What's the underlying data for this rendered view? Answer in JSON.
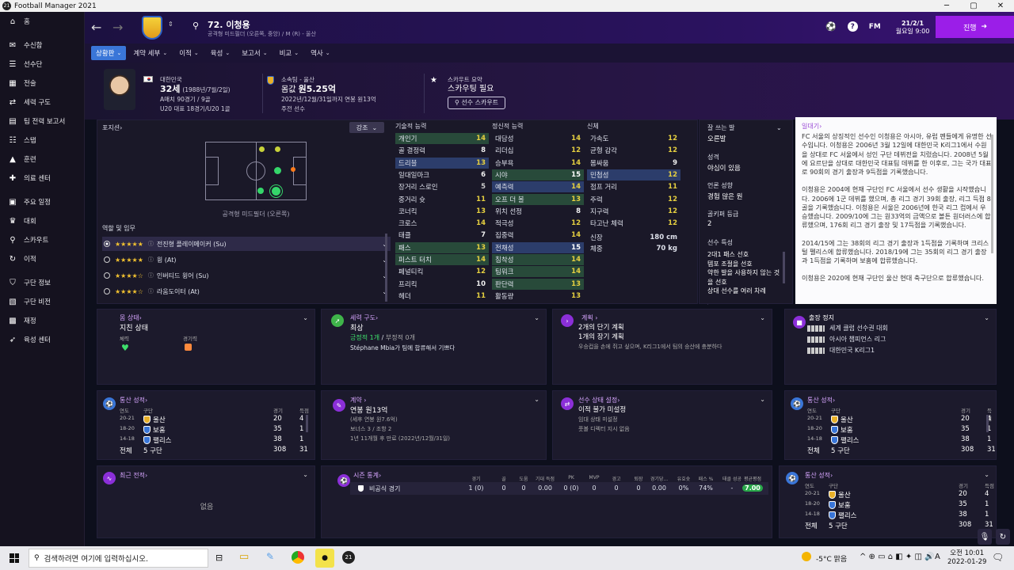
{
  "app": {
    "title": "Football Manager 2021"
  },
  "sidebar": {
    "items": [
      {
        "label": "홈",
        "icon": "home-icon"
      },
      {
        "label": "수신함",
        "icon": "inbox-icon"
      },
      {
        "label": "선수단",
        "icon": "squad-icon"
      },
      {
        "label": "전술",
        "icon": "tactics-icon"
      },
      {
        "label": "세력 구도",
        "icon": "dynamics-icon"
      },
      {
        "label": "팀 전력 보고서",
        "icon": "report-icon"
      },
      {
        "label": "스탭",
        "icon": "staff-icon"
      },
      {
        "label": "훈련",
        "icon": "training-icon"
      },
      {
        "label": "의료 센터",
        "icon": "medical-icon"
      },
      {
        "label": "주요 일정",
        "icon": "calendar-icon"
      },
      {
        "label": "대회",
        "icon": "trophy-icon"
      },
      {
        "label": "스카우트",
        "icon": "scout-icon"
      },
      {
        "label": "이적",
        "icon": "transfer-icon"
      },
      {
        "label": "구단 정보",
        "icon": "club-info-icon"
      },
      {
        "label": "구단 비전",
        "icon": "vision-icon"
      },
      {
        "label": "재정",
        "icon": "finance-icon"
      },
      {
        "label": "육성 센터",
        "icon": "development-icon"
      }
    ]
  },
  "topbar": {
    "player_title": "72. 이청용",
    "player_sub": "공격형 미드필더 (오른쪽, 중앙) / M (R) - 울산",
    "fm": "FM",
    "date": "21/2/1",
    "time": "월요일 9:00",
    "continue_label": "진행"
  },
  "tabs": [
    "상황판",
    "계약 세부",
    "이적",
    "육성",
    "보고서",
    "비교",
    "역사"
  ],
  "header": {
    "nation": "대한민국",
    "age": "32세",
    "dob": "(1988년/7월/2일)",
    "a_caps": "A매치 90경기 / 9골",
    "u_caps": "U20 대표 18경기/U20 1골",
    "club_label": "소속팀 - 울산",
    "value_label": "몸값 ",
    "value": "원5.25억",
    "contract": "2022년/12월/31일까지 연봉 원13억",
    "role": "주전 선수",
    "scout_label": "스카우트 요약",
    "scout_need": "스카우팅 필요",
    "scout_btn": "선수 스카우트"
  },
  "position": {
    "title": "포지션",
    "strong_label": "강조",
    "pitch_caption": "공격형 미드필더 (오른쪽)",
    "roles_title": "역할 및 임무",
    "roles": [
      {
        "stars": "★★★★★",
        "name": "전진형 플레이메이커 (Su)"
      },
      {
        "stars": "★★★★★",
        "name": "윙 (At)"
      },
      {
        "stars": "★★★★☆",
        "name": "인버티드 윙어 (Su)"
      },
      {
        "stars": "★★★★☆",
        "name": "라움도이터 (At)"
      }
    ]
  },
  "attributes": {
    "technical_title": "기술적 능력",
    "mental_title": "정신적 능력",
    "physical_title": "신체",
    "technical": [
      [
        "개인기",
        "14"
      ],
      [
        "골 결정력",
        "8"
      ],
      [
        "드리블",
        "13"
      ],
      [
        "일대일마크",
        "6"
      ],
      [
        "장거리 스로인",
        "5"
      ],
      [
        "중거리 슛",
        "11"
      ],
      [
        "코너킥",
        "13"
      ],
      [
        "크로스",
        "14"
      ],
      [
        "태클",
        "7"
      ],
      [
        "패스",
        "13"
      ],
      [
        "퍼스트 터치",
        "14"
      ],
      [
        "페널티킥",
        "12"
      ],
      [
        "프리킥",
        "10"
      ],
      [
        "헤더",
        "11"
      ]
    ],
    "mental": [
      [
        "대담성",
        "14"
      ],
      [
        "리더십",
        "12"
      ],
      [
        "승부욕",
        "14"
      ],
      [
        "시야",
        "15"
      ],
      [
        "예측력",
        "14"
      ],
      [
        "오프 더 볼",
        "13"
      ],
      [
        "위치 선정",
        "8"
      ],
      [
        "적극성",
        "12"
      ],
      [
        "집중력",
        "14"
      ],
      [
        "전채성",
        "15"
      ],
      [
        "침착성",
        "14"
      ],
      [
        "팀워크",
        "14"
      ],
      [
        "판단력",
        "13"
      ],
      [
        "활동량",
        "13"
      ]
    ],
    "physical": [
      [
        "가속도",
        "12"
      ],
      [
        "균형 감각",
        "12"
      ],
      [
        "몸싸움",
        "9"
      ],
      [
        "민첩성",
        "12"
      ],
      [
        "점프 거리",
        "11"
      ],
      [
        "주력",
        "12"
      ],
      [
        "지구력",
        "12"
      ],
      [
        "타고난 체력",
        "12"
      ]
    ],
    "height_label": "신장",
    "height": "180 cm",
    "weight_label": "체중",
    "weight": "70 kg"
  },
  "traits": {
    "foot_label": "잘 쓰는 발",
    "foot": "오른발",
    "personality_label": "성격",
    "personality": "야심이 있음",
    "media_label": "언론 성향",
    "media": "경험 많은 원",
    "gk_label": "골키퍼 등급",
    "gk": "2",
    "traits_label": "선수 특성",
    "traits": [
      "2대1 패스 선호",
      "템포 조절을 선호",
      "약한 발을 사용하지 않는 것을 선호",
      "상대 선수를 여러 차례"
    ]
  },
  "bio": {
    "title": "일대기",
    "p1": "FC 서울의 상징적인 선수인 이청용은 아시아, 유럽 펜들에게 유명한 선수입니다. 이청용은 2006년 3월 12일에 대한민국 K리그1에서 수원을 상대로 FC 서울에서 성인 구단 데뷔전을 치렀습니다. 2008년 5월에 요르단을 상대로 대한민국 대표팀 데뷔를 한 이후로, 그는 국가 대표로 90회의 경기 출장과 9득점을 기록했습니다.",
    "p2": "이청용은 2004에 현재 구단인 FC 서울에서 선수 생활을 시작했습니다. 2006에 1군 데뷔를 했으며, 총 리그 경기 39회 출장, 리그 득점 8골을 기록했습니다. 이청용은 서울은 2006년에 한국 리그 컵에서 우승했습니다. 2009/10에 그는 원33억의 금액으로 볼튼 원더러스에 합류했으며, 176회 리그 경기 출장 및 17득점을 기록했습니다.",
    "p3": "2014/15에 그는 38회의 리그 경기 출장과 1득점을 기록하며 크리스털 펠리스에 합류했습니다. 2018/19에 그는 35회의 리그 경기 출장과 1득점을 기록하며 보훔에 합류했습니다.",
    "p4": "이청용은 2020에 현재 구단인 울산 현대 축구단으로 합류했습니다."
  },
  "condition": {
    "title": "몸 상태",
    "value": "지친 상태",
    "fitness_label": "체력",
    "match_label": "경기력"
  },
  "dynamics": {
    "title": "세력 구도",
    "value": "최상",
    "positive": "긍정적 1개",
    "negative": "부정적 0개",
    "note": "Stéphane Mbia가 팀에 합류해서 기쁘다"
  },
  "plans": {
    "title": "계획",
    "short": "2개의 단기 계획",
    "long": "1개의 장기 계획",
    "note": "우승컵을 손에 쥐고 싶으며, K리그1에서 팀의 승산에 충분하다"
  },
  "ambitions": {
    "title": "출장 정지",
    "items": [
      "세계 클럽 선수권 대회",
      "아시아 챔피언스 리그",
      "대한민국 K리그1"
    ]
  },
  "career1": {
    "title": "통산 성적",
    "cols": [
      "연도",
      "구단",
      "경기",
      "득점"
    ],
    "rows": [
      [
        "20-21",
        "울산",
        "20",
        "4"
      ],
      [
        "18-20",
        "보훔",
        "35",
        "1"
      ],
      [
        "14-18",
        "팰리스",
        "38",
        "1"
      ]
    ],
    "total": [
      "전체",
      "5 구단",
      "308",
      "31"
    ]
  },
  "contract": {
    "title": "계약",
    "value": "연봉 원13억",
    "sub": "(세후 연봉 원7.6억)",
    "bonus": "보너스 3 / 조항 2",
    "remaining": "1년 11개월 후 만료 (2022년/12월/31일)"
  },
  "status": {
    "title": "선수 상태 설정",
    "value": "이적 불가 미설정",
    "line2": "임대 상태 미설정",
    "line3": "풋볼 디렉터 지시 없음"
  },
  "career2": {
    "title": "통산 성적",
    "cols": [
      "연도",
      "구단",
      "경기",
      "득점"
    ],
    "rows": [
      [
        "20-21",
        "울산",
        "20",
        "4"
      ],
      [
        "18-20",
        "보훔",
        "35",
        "1"
      ],
      [
        "14-18",
        "팰리스",
        "38",
        "1"
      ]
    ],
    "total": [
      "전체",
      "5 구단",
      "308",
      "31"
    ]
  },
  "form": {
    "title": "최근 전적",
    "empty": "없음"
  },
  "season": {
    "title": "시즌 통계",
    "cols": [
      "경기",
      "골",
      "도움",
      "기대 득점",
      "PK",
      "MVP",
      "경고",
      "퇴장",
      "경기당...",
      "유효슛",
      "패스 %",
      "태클 성공",
      "평균평점"
    ],
    "row_label": "비공식 경기",
    "values": [
      "1 (0)",
      "0",
      "0",
      "0.00",
      "0 (0)",
      "0",
      "0",
      "0",
      "0.00",
      "0%",
      "74%",
      "-",
      "7.00"
    ]
  },
  "career3": {
    "title": "통산 성적",
    "cols": [
      "연도",
      "구단",
      "경기",
      "득점"
    ],
    "rows": [
      [
        "20-21",
        "울산",
        "20",
        "4"
      ],
      [
        "18-20",
        "보훔",
        "35",
        "1"
      ],
      [
        "14-18",
        "팰리스",
        "38",
        "1"
      ]
    ],
    "total": [
      "전체",
      "5 구단",
      "308",
      "31"
    ]
  },
  "taskbar": {
    "search": "검색하려면 여기에 입력하십시오.",
    "weather": "-5°C 맑음",
    "time": "오전 10:01",
    "date": "2022-01-29",
    "lang": "A"
  },
  "colors": {
    "accent": "#9b1ee8",
    "tab_active": "#3a76d8",
    "attr_green": "#e6d040",
    "title_purple": "#d7a6ff"
  }
}
